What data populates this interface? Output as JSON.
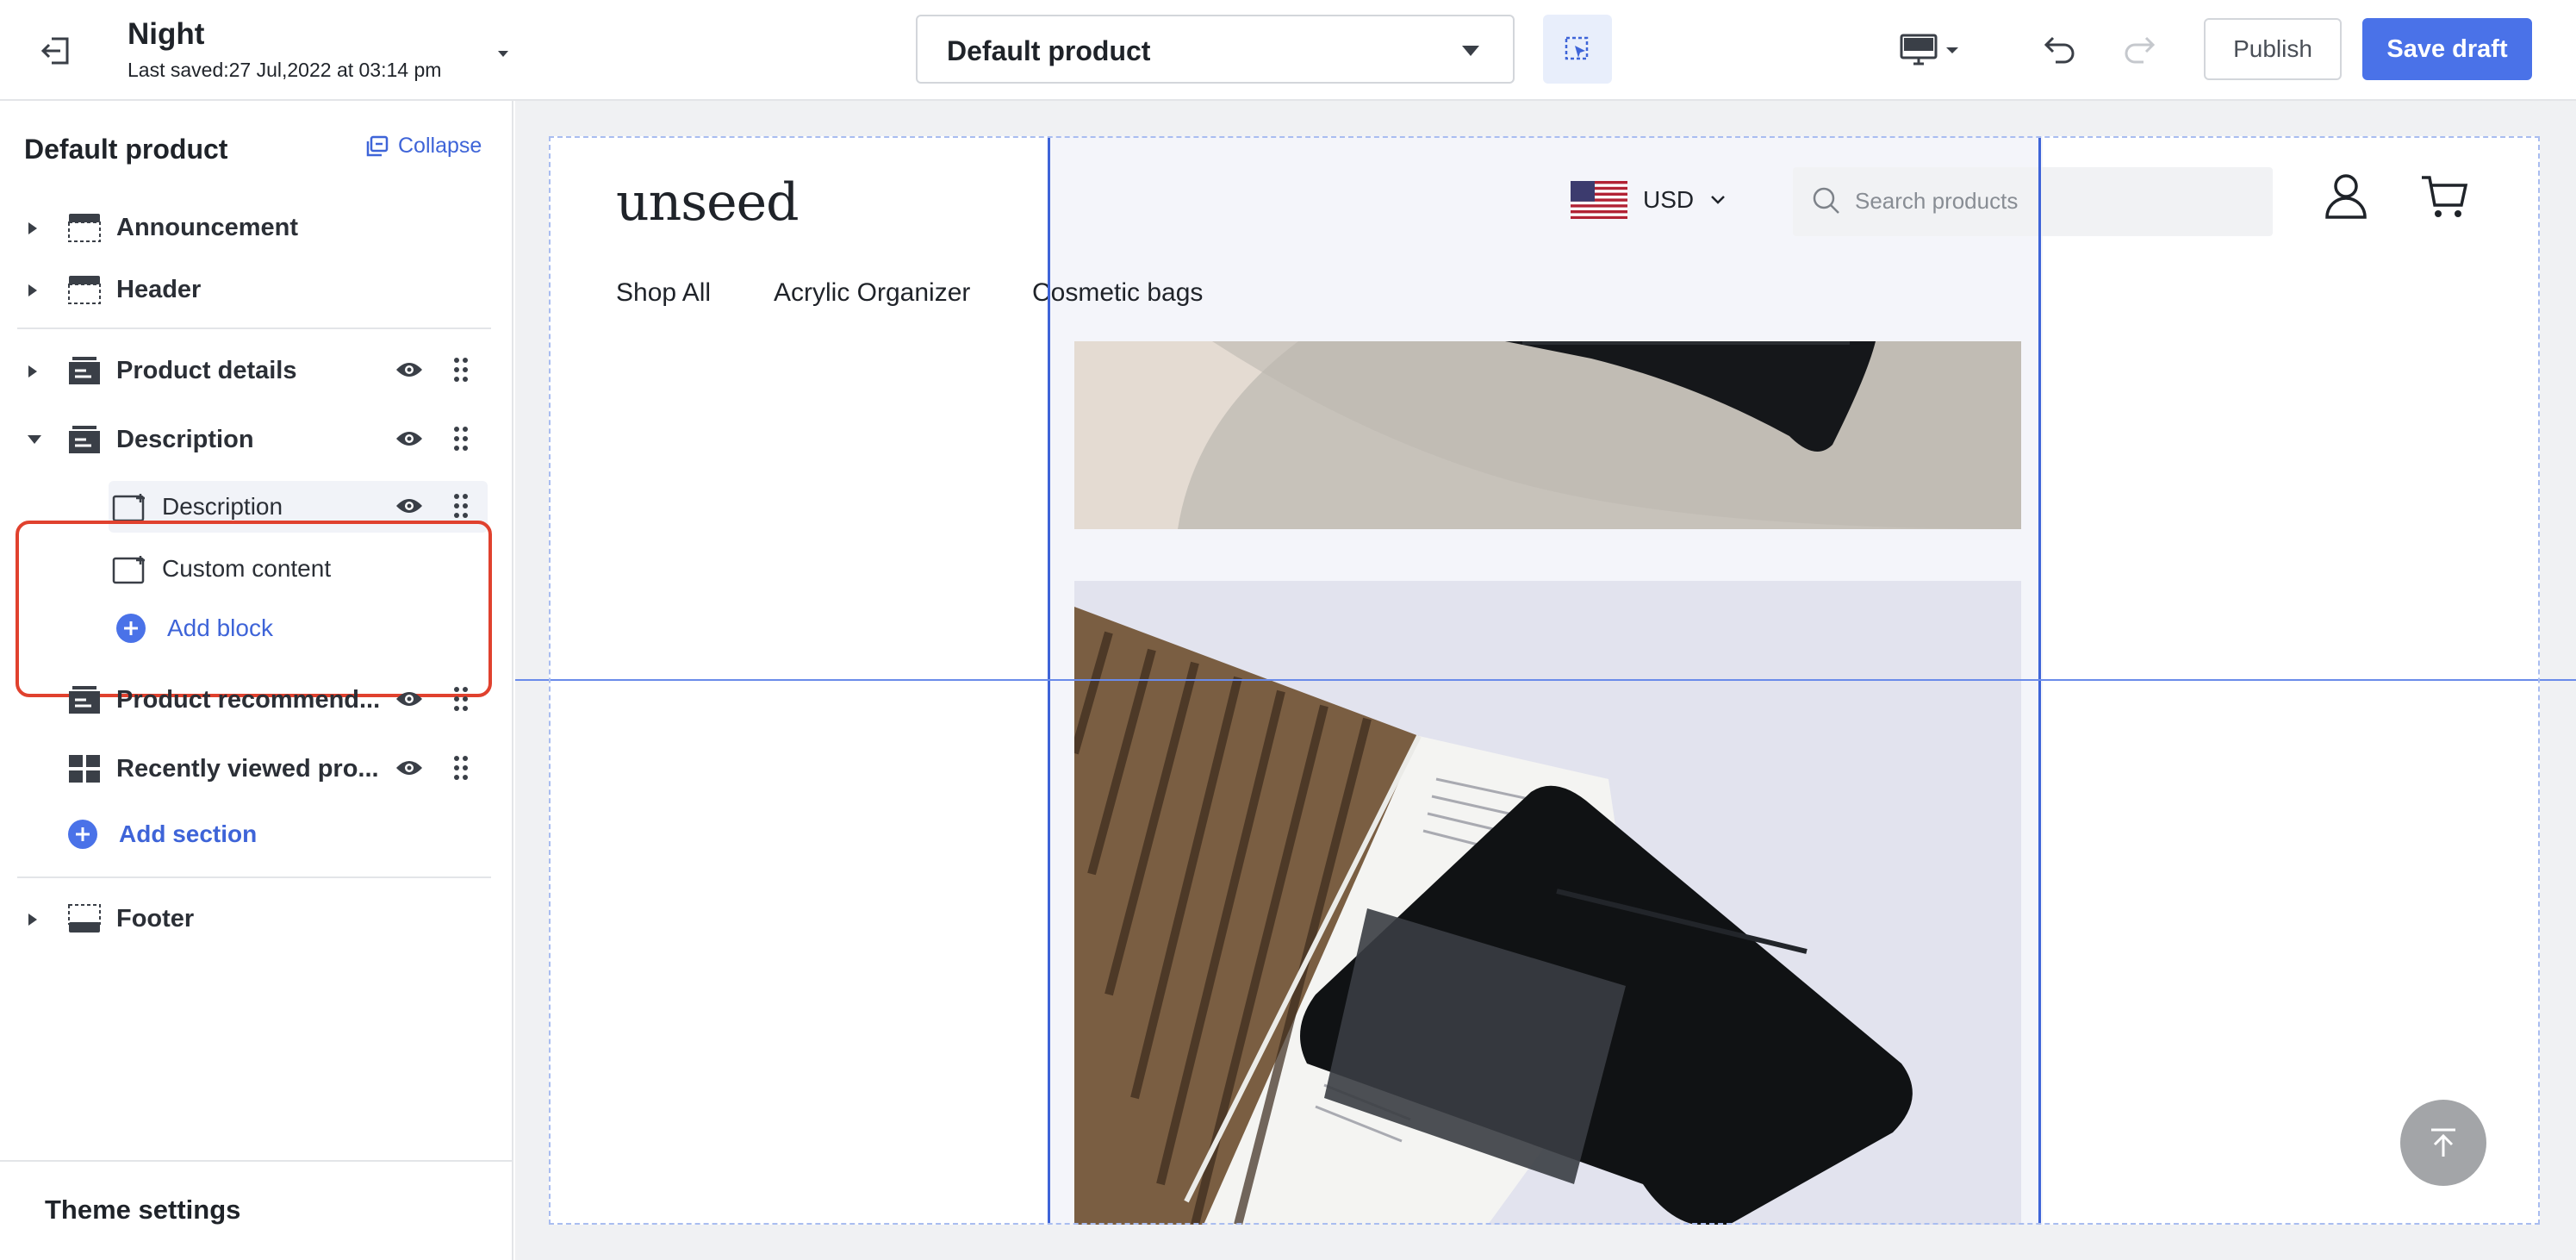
{
  "topbar": {
    "theme_name": "Night",
    "last_saved": "Last saved:27 Jul,2022 at 03:14 pm",
    "page_selector": "Default product",
    "publish_label": "Publish",
    "save_label": "Save draft"
  },
  "sidebar": {
    "title": "Default product",
    "collapse_label": "Collapse",
    "sections_top": [
      {
        "label": "Announcement"
      },
      {
        "label": "Header"
      }
    ],
    "sections_main": [
      {
        "label": "Product details"
      },
      {
        "label": "Description"
      }
    ],
    "description_blocks": [
      {
        "label": "Description"
      },
      {
        "label": "Custom content"
      }
    ],
    "add_block_label": "Add block",
    "sections_more": [
      {
        "label": "Product recommend..."
      },
      {
        "label": "Recently viewed pro..."
      }
    ],
    "add_section_label": "Add section",
    "footer_section": {
      "label": "Footer"
    },
    "theme_settings_label": "Theme settings"
  },
  "preview": {
    "logo": "unseed",
    "currency": "USD",
    "search_placeholder": "Search products",
    "nav": [
      "Shop All",
      "Acrylic Organizer",
      "Cosmetic bags"
    ]
  },
  "colors": {
    "accent": "#4a72e8",
    "highlight": "#e0412e",
    "guide": "#3e64d8"
  }
}
